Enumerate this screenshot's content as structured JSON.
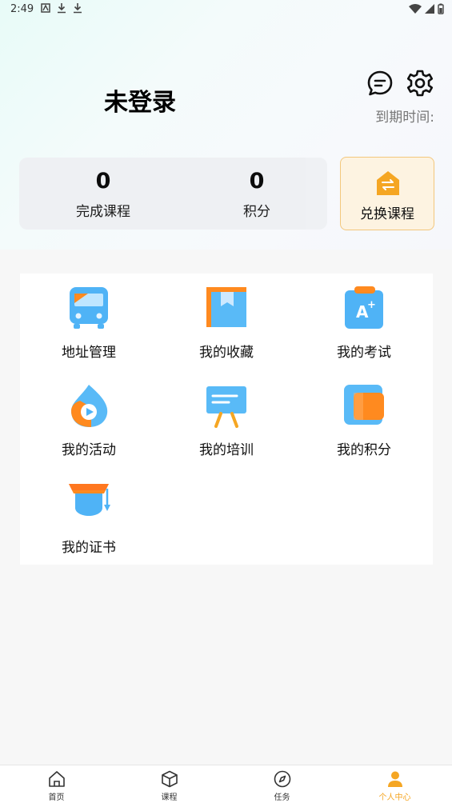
{
  "status_bar": {
    "time": "2:49"
  },
  "profile": {
    "username": "未登录",
    "expire_label": "到期时间:"
  },
  "stats": [
    {
      "value": "0",
      "label": "完成课程"
    },
    {
      "value": "0",
      "label": "积分"
    }
  ],
  "exchange": {
    "label": "兑换课程"
  },
  "menu": [
    {
      "label": "地址管理",
      "icon": "bus-icon"
    },
    {
      "label": "我的收藏",
      "icon": "collection-icon"
    },
    {
      "label": "我的考试",
      "icon": "exam-icon"
    },
    {
      "label": "我的活动",
      "icon": "activity-icon"
    },
    {
      "label": "我的培训",
      "icon": "training-board-icon"
    },
    {
      "label": "我的积分",
      "icon": "points-card-icon"
    },
    {
      "label": "我的证书",
      "icon": "graduation-cap-icon"
    }
  ],
  "tabbar": [
    {
      "label": "首页",
      "icon": "home-icon",
      "active": false
    },
    {
      "label": "课程",
      "icon": "cube-icon",
      "active": false
    },
    {
      "label": "任务",
      "icon": "compass-icon",
      "active": false
    },
    {
      "label": "个人中心",
      "icon": "person-icon",
      "active": true
    }
  ],
  "colors": {
    "accent": "#f5a623",
    "blue": "#4fb3f6",
    "orange": "#ff8a1f"
  }
}
